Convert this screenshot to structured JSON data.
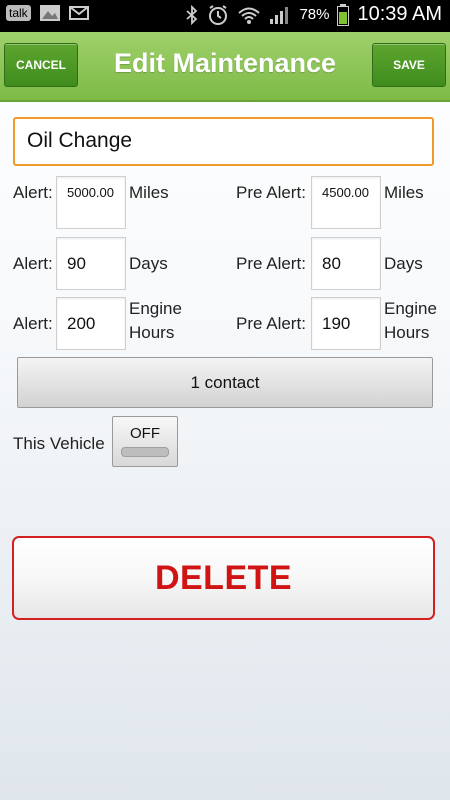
{
  "status_bar": {
    "talk_label": "talk",
    "battery_percent": "78%",
    "time": "10:39 AM"
  },
  "titlebar": {
    "cancel_label": "CANCEL",
    "title": "Edit Maintenance",
    "save_label": "SAVE"
  },
  "name_field": {
    "value": "Oil Change"
  },
  "alerts": {
    "miles": {
      "alert_label": "Alert:",
      "alert_value": "5000.00",
      "unit": "Miles",
      "pre_label": "Pre Alert:",
      "pre_value": "4500.00"
    },
    "days": {
      "alert_label": "Alert:",
      "alert_value": "90",
      "unit": "Days",
      "pre_label": "Pre Alert:",
      "pre_value": "80"
    },
    "hours": {
      "alert_label": "Alert:",
      "alert_value": "200",
      "unit_line1": "Engine",
      "unit_line2": "Hours",
      "pre_label": "Pre Alert:",
      "pre_value": "190"
    }
  },
  "contact_button": {
    "label": "1 contact"
  },
  "vehicle_toggle": {
    "label": "This Vehicle",
    "state": "OFF"
  },
  "delete_button": {
    "label": "DELETE"
  },
  "colors": {
    "title_green": "#7dbb46",
    "focus_orange": "#f09a2c",
    "delete_red": "#d01414"
  }
}
